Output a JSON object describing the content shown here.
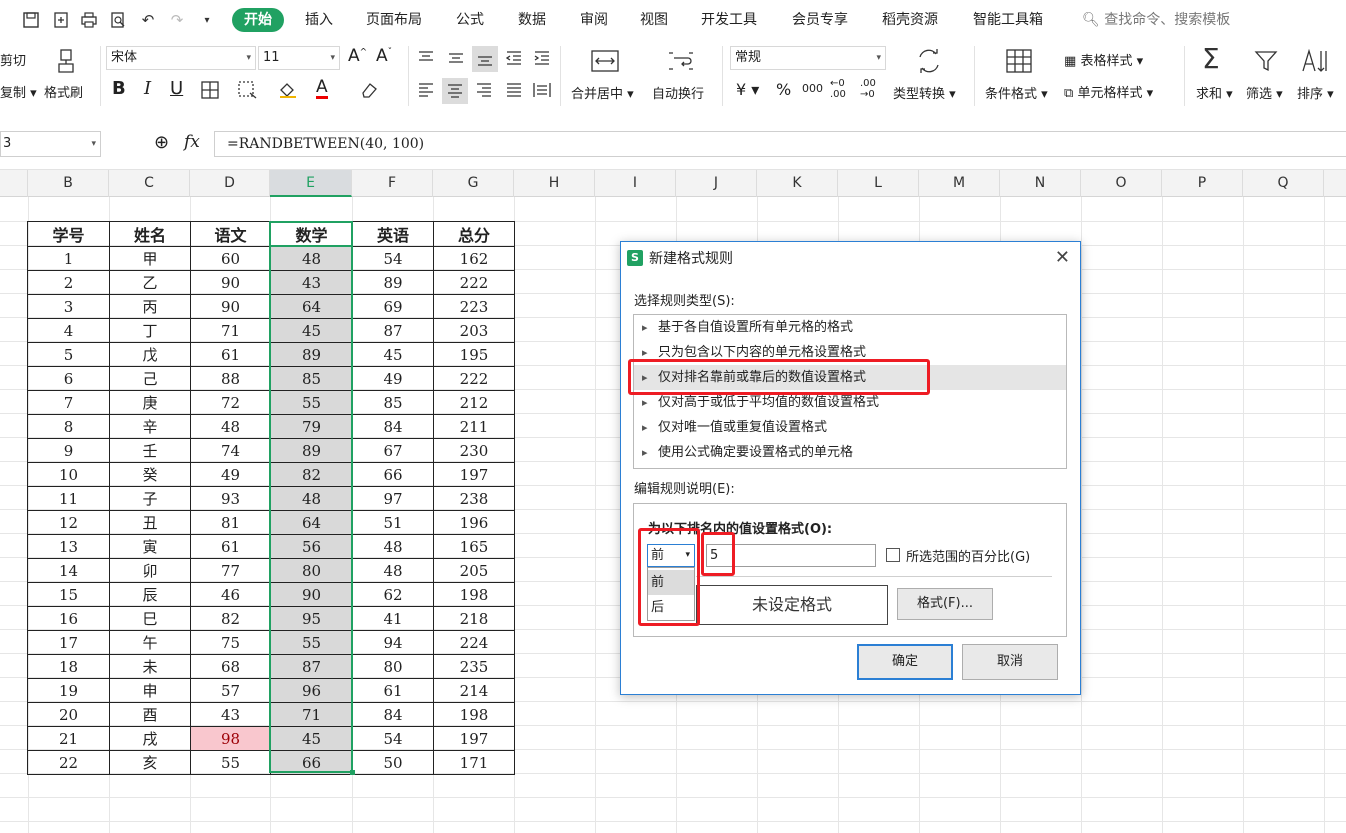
{
  "menubar": {
    "tabs": [
      "开始",
      "插入",
      "页面布局",
      "公式",
      "数据",
      "审阅",
      "视图",
      "开发工具",
      "会员专享",
      "稻壳资源",
      "智能工具箱"
    ],
    "search": "查找命令、搜索模板"
  },
  "ribbon": {
    "cut": "剪切",
    "copy": "复制",
    "format_painter": "格式刷",
    "font_name": "宋体",
    "font_size": "11",
    "merge_center": "合并居中",
    "wrap_text": "自动换行",
    "number_format": "常规",
    "type_convert": "类型转换",
    "conditional_format": "条件格式",
    "table_style": "表格样式",
    "cell_style": "单元格样式",
    "sum": "求和",
    "filter": "筛选",
    "sort": "排序",
    "bold": "B",
    "italic": "I",
    "underline": "U",
    "currency": "¥",
    "percent": "%",
    "thousands": "000",
    "dec_inc": "←0 .00",
    "dec_dec": ".00 →0"
  },
  "formula_bar": {
    "name_box": "3",
    "fx": "fx",
    "formula": "=RANDBETWEEN(40, 100)"
  },
  "sheet": {
    "columns": [
      "B",
      "C",
      "D",
      "E",
      "F",
      "G",
      "H",
      "I",
      "J",
      "K",
      "L",
      "M",
      "N",
      "O",
      "P",
      "Q"
    ],
    "selected_column": "E",
    "headers": [
      "学号",
      "姓名",
      "语文",
      "数学",
      "英语",
      "总分"
    ],
    "rows": [
      [
        "1",
        "甲",
        "60",
        "48",
        "54",
        "162"
      ],
      [
        "2",
        "乙",
        "90",
        "43",
        "89",
        "222"
      ],
      [
        "3",
        "丙",
        "90",
        "64",
        "69",
        "223"
      ],
      [
        "4",
        "丁",
        "71",
        "45",
        "87",
        "203"
      ],
      [
        "5",
        "戊",
        "61",
        "89",
        "45",
        "195"
      ],
      [
        "6",
        "己",
        "88",
        "85",
        "49",
        "222"
      ],
      [
        "7",
        "庚",
        "72",
        "55",
        "85",
        "212"
      ],
      [
        "8",
        "辛",
        "48",
        "79",
        "84",
        "211"
      ],
      [
        "9",
        "壬",
        "74",
        "89",
        "67",
        "230"
      ],
      [
        "10",
        "癸",
        "49",
        "82",
        "66",
        "197"
      ],
      [
        "11",
        "子",
        "93",
        "48",
        "97",
        "238"
      ],
      [
        "12",
        "丑",
        "81",
        "64",
        "51",
        "196"
      ],
      [
        "13",
        "寅",
        "61",
        "56",
        "48",
        "165"
      ],
      [
        "14",
        "卯",
        "77",
        "80",
        "48",
        "205"
      ],
      [
        "15",
        "辰",
        "46",
        "90",
        "62",
        "198"
      ],
      [
        "16",
        "巳",
        "82",
        "95",
        "41",
        "218"
      ],
      [
        "17",
        "午",
        "75",
        "55",
        "94",
        "224"
      ],
      [
        "18",
        "未",
        "68",
        "87",
        "80",
        "235"
      ],
      [
        "19",
        "申",
        "57",
        "96",
        "61",
        "214"
      ],
      [
        "20",
        "酉",
        "43",
        "71",
        "84",
        "198"
      ],
      [
        "21",
        "戌",
        "98",
        "45",
        "54",
        "197"
      ],
      [
        "22",
        "亥",
        "55",
        "66",
        "50",
        "171"
      ]
    ],
    "highlighted_cell": {
      "row": 21,
      "col": 3,
      "color": "#f9c7ce"
    }
  },
  "dialog": {
    "title": "新建格式规则",
    "rule_type_label": "选择规则类型(S):",
    "rule_types": [
      "基于各自值设置所有单元格的格式",
      "只为包含以下内容的单元格设置格式",
      "仅对排名靠前或靠后的数值设置格式",
      "仅对高于或低于平均值的数值设置格式",
      "仅对唯一值或重复值设置格式",
      "使用公式确定要设置格式的单元格"
    ],
    "selected_rule_index": 2,
    "edit_label": "编辑规则说明(E):",
    "section_title": "为以下排名内的值设置格式(O):",
    "rank_value": "前",
    "rank_options": [
      "前",
      "后"
    ],
    "rank_number": "5",
    "percent_label": "所选范围的百分比(G)",
    "preview": "未设定格式",
    "format_button": "格式(F)...",
    "ok": "确定",
    "cancel": "取消"
  },
  "colors": {
    "accent": "#20a162",
    "annotation": "#ee1c24",
    "dialog_border": "#2b7fd4"
  }
}
